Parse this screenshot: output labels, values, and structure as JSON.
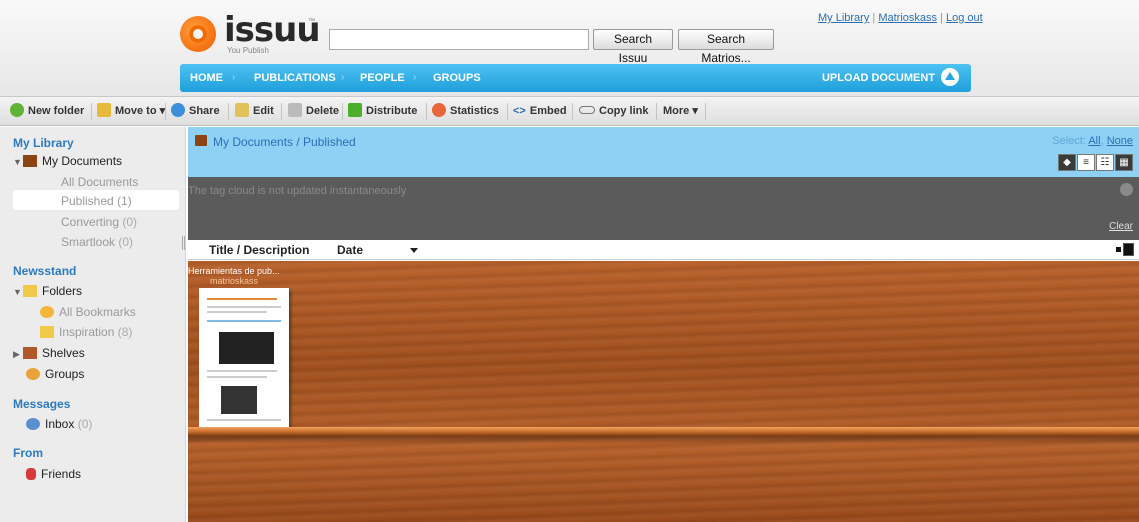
{
  "header": {
    "logo_text": "issuu",
    "logo_tm": "™",
    "logo_tagline": "You Publish",
    "search_value": "",
    "search_issuu_label": "Search Issuu",
    "search_user_label": "Search Matrios...",
    "user_links": [
      "My Library",
      "Matrioskass",
      "Log out"
    ],
    "nav": [
      "HOME",
      "PUBLICATIONS",
      "PEOPLE",
      "GROUPS"
    ],
    "upload_label": "UPLOAD DOCUMENT"
  },
  "toolbar": {
    "new_folder": "New folder",
    "move_to": "Move to",
    "share": "Share",
    "edit": "Edit",
    "delete": "Delete",
    "distribute": "Distribute",
    "statistics": "Statistics",
    "embed": "Embed",
    "copy_link": "Copy link",
    "more": "More"
  },
  "sidebar": {
    "my_library": "My Library",
    "my_documents": "My Documents",
    "all_documents": "All Documents",
    "published": "Published",
    "published_count": "(1)",
    "converting": "Converting",
    "converting_count": "(0)",
    "smartlook": "Smartlook",
    "smartlook_count": "(0)",
    "newsstand": "Newsstand",
    "folders": "Folders",
    "all_bookmarks": "All Bookmarks",
    "inspiration": "Inspiration",
    "inspiration_count": "(8)",
    "shelves": "Shelves",
    "groups": "Groups",
    "messages": "Messages",
    "inbox": "Inbox",
    "inbox_count": "(0)",
    "from": "From",
    "friends": "Friends"
  },
  "main": {
    "breadcrumb": "My Documents / Published",
    "select_label": "Select:",
    "select_all": "All",
    "select_none": "None",
    "tag_message": "The tag cloud is not updated instantaneously",
    "clear": "Clear",
    "col_title": "Title / Description",
    "col_date": "Date",
    "document": {
      "title": "Herramientas de pub...",
      "author": "matrioskass"
    }
  }
}
